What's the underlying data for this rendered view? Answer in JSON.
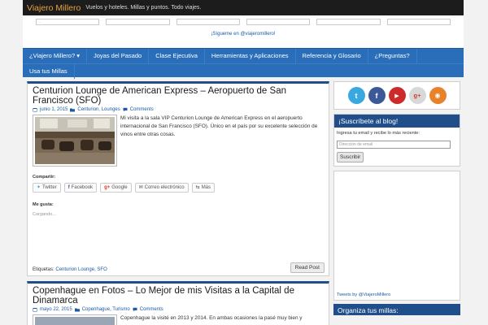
{
  "header": {
    "site_title": "Viajero Millero",
    "site_description": "Vuelos y hoteles. Millas y puntos. Todo viajes.",
    "follow_text": "¡Sígueme en @viajeromillero!",
    "slot_first_text": "..."
  },
  "nav": {
    "items": [
      "¿Viajero Millero? ▾",
      "Joyas del Pasado",
      "Clase Ejecutiva",
      "Herramientas y Aplicaciones",
      "Referencia y Glosario",
      "¿Preguntas?"
    ],
    "second_row": [
      "Usa tus Millas"
    ]
  },
  "posts": [
    {
      "title": "Centurion Lounge de American Express – Aeropuerto de San Francisco (SFO)",
      "date": "junio 1, 2015",
      "categories": "Centurion, Lounges",
      "comments": "Comments",
      "excerpt": "Mi visita a la sala VIP Centurion Lounge de American Express en el aeropuerto internacional de San Francisco (SFO). Único en el país por su excelente selección de vinos entre otras cosas.",
      "share_label": "Compartir:",
      "share_buttons": [
        "Twitter",
        "Facebook",
        "Google",
        "Correo electrónico",
        "Más"
      ],
      "like_label": "Me gusta:",
      "loading_text": "Cargando...",
      "tags_label": "Etiquetas:",
      "tags": "Centurion Lounge, SFO",
      "read_post": "Read Post"
    },
    {
      "title": "Copenhague en Fotos – Lo Mejor de mis Visitas a la Capital de Dinamarca",
      "date": "mayo 22, 2015",
      "categories": "Copenhague, Turismo",
      "comments": "Comments",
      "excerpt": "Copenhague la visité en 2013 y 2014. En ambas ocasiones la pasé muy bien y"
    }
  ],
  "sidebar": {
    "social_icons": [
      {
        "name": "twitter-icon",
        "glyph": "t",
        "color": "#3aa8e0"
      },
      {
        "name": "facebook-icon",
        "glyph": "f",
        "color": "#3b5998"
      },
      {
        "name": "youtube-icon",
        "glyph": "▶",
        "color": "#cc2b2b"
      },
      {
        "name": "googleplus-icon",
        "glyph": "g+",
        "color": "#d8d8d8"
      },
      {
        "name": "rss-icon",
        "glyph": "◉",
        "color": "#e8822a"
      }
    ],
    "subscribe_title": "¡Suscríbete al blog!",
    "subscribe_text": "Ingresa tu email y recibe lo más reciente:",
    "email_placeholder": "Dirección de email",
    "subscribe_button": "Suscribir",
    "tweets_link": "Tweets by @ViajeroMillero",
    "organize_title": "Organiza tus millas:"
  },
  "colors": {
    "nav": "#2a6db8",
    "accent": "#1f4e8a",
    "title": "#e8a33c"
  }
}
